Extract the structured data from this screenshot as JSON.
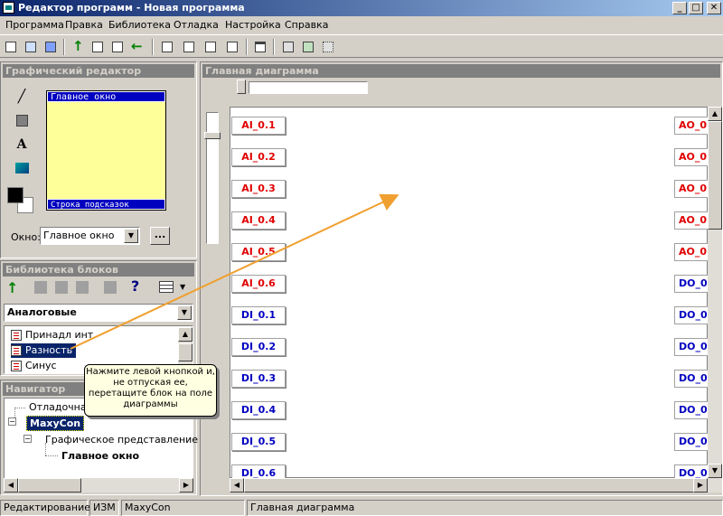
{
  "window": {
    "title": "Редактор программ - Новая программа"
  },
  "menu": [
    "Программа",
    "Правка",
    "Библиотека",
    "Отладка",
    "Настройка",
    "Справка"
  ],
  "graphic_editor": {
    "header": "Графический редактор",
    "screen_title": "Главное окно",
    "screen_hint": "Строка подсказок",
    "window_label": "Окно:",
    "window_value": "Главное окно",
    "more_button": "..."
  },
  "library": {
    "header": "Библиотека блоков",
    "category": "Аналоговые",
    "items": [
      "Принадл инт",
      "Разность",
      "Синус"
    ]
  },
  "navigator": {
    "header": "Навигатор",
    "items": [
      "Отладочная",
      "MaxyCon",
      "Графическое представление",
      "Главное окно"
    ]
  },
  "diagram": {
    "header": "Главная диаграмма",
    "inputs": [
      "AI_0.1",
      "AI_0.2",
      "AI_0.3",
      "AI_0.4",
      "AI_0.5",
      "AI_0.6",
      "DI_0.1",
      "DI_0.2",
      "DI_0.3",
      "DI_0.4",
      "DI_0.5",
      "DI_0.6"
    ],
    "outputs": [
      "AO_0",
      "AO_0",
      "AO_0",
      "AO_0",
      "AO_0",
      "DO_0",
      "DO_0",
      "DO_0",
      "DO_0",
      "DO_0",
      "DO_0",
      "DO_0"
    ]
  },
  "tooltip": {
    "text": "Нажмите левой кнопкой и, не отпуская ее, перетащите блок на поле диаграммы"
  },
  "status": [
    "Редактирование",
    "ИЗМ",
    "MaxyCon",
    "Главная диаграмма"
  ],
  "colors": {
    "titlebar": "#0a246a",
    "analog": "#e00000",
    "digital": "#0000c0",
    "arrow": "#f0a030"
  }
}
